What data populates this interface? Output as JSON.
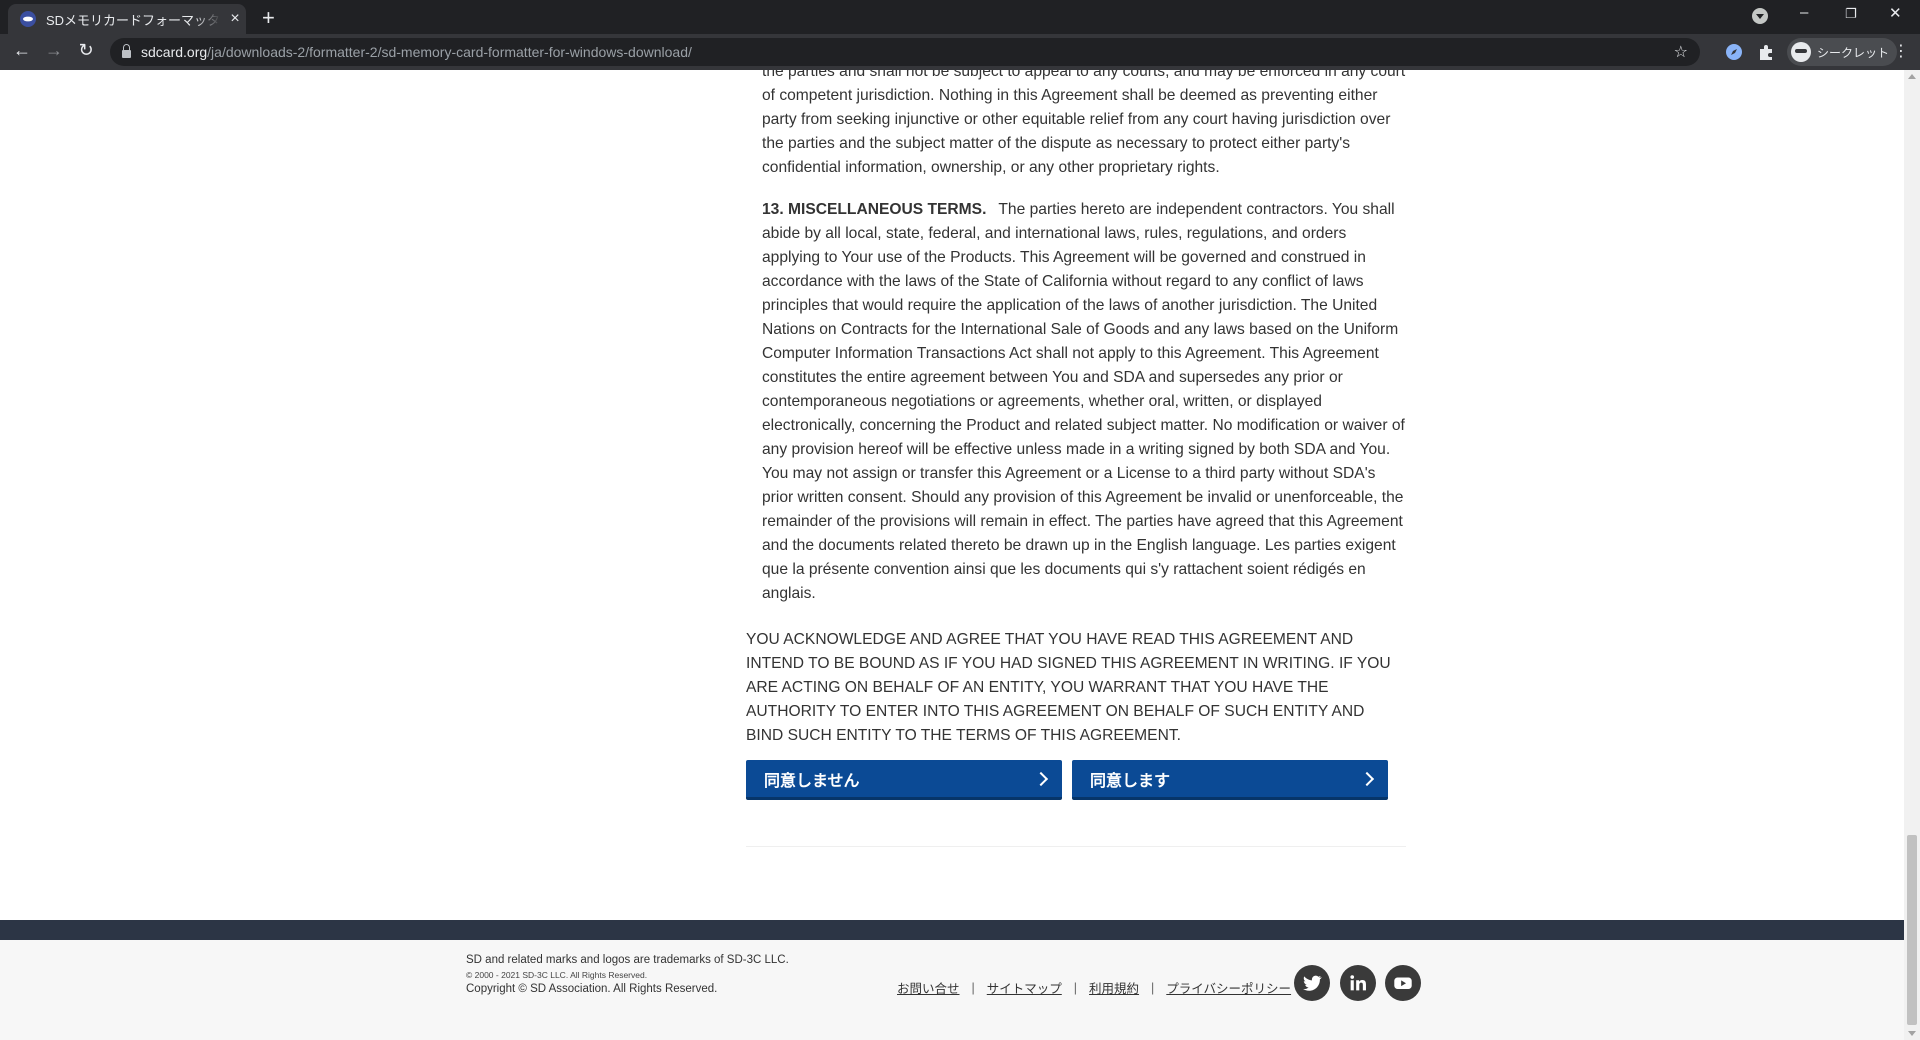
{
  "browser": {
    "tab_title": "SDメモリカードフォーマッター Windows",
    "url_host": "sdcard.org",
    "url_path": "/ja/downloads-2/formatter-2/sd-memory-card-formatter-for-windows-download/",
    "profile_label": "シークレット"
  },
  "agreement": {
    "para12_tail": "the parties and shall not be subject to appeal to any courts, and may be enforced in any court of competent jurisdiction. Nothing in this Agreement shall be deemed as preventing either party from seeking injunctive or other equitable relief from any court having jurisdiction over the parties and the subject matter of the dispute as necessary to protect either party's confidential information, ownership, or any other proprietary rights.",
    "para13_heading": "13. MISCELLANEOUS TERMS.",
    "para13_body": "The parties hereto are independent contractors. You shall abide by all local, state, federal, and international laws, rules, regulations, and orders applying to Your use of the Products. This Agreement will be governed and construed in accordance with the laws of the State of California without regard to any conflict of laws principles that would require the application of the laws of another jurisdiction. The United Nations on Contracts for the International Sale of Goods and any laws based on the Uniform Computer Information Transactions Act shall not apply to this Agreement. This Agreement constitutes the entire agreement between You and SDA and supersedes any prior or contemporaneous negotiations or agreements, whether oral, written, or displayed electronically, concerning the Product and related subject matter. No modification or waiver of any provision hereof will be effective unless made in a writing signed by both SDA and You. You may not assign or transfer this Agreement or a License to a third party without SDA's prior written consent. Should any provision of this Agreement be invalid or unenforceable, the remainder of the provisions will remain in effect. The parties have agreed that this Agreement and the documents related thereto be drawn up in the English language. Les parties exigent que la présente convention ainsi que les documents qui s'y rattachent soient rédigés en anglais.",
    "acknowledgement": "YOU ACKNOWLEDGE AND AGREE THAT YOU HAVE READ THIS AGREEMENT AND INTEND TO BE BOUND AS IF YOU HAD SIGNED THIS AGREEMENT IN WRITING. IF YOU ARE ACTING ON BEHALF OF AN ENTITY, YOU WARRANT THAT YOU HAVE THE AUTHORITY TO ENTER INTO THIS AGREEMENT ON BEHALF OF SUCH ENTITY AND BIND SUCH ENTITY TO THE TERMS OF THIS AGREEMENT.",
    "decline_label": "同意しません",
    "accept_label": "同意します"
  },
  "footer": {
    "trademark": "SD and related marks and logos are trademarks of SD-3C LLC.",
    "small_copyright": "© 2000 - 2021 SD-3C LLC. All Rights Reserved.",
    "copyright": "Copyright © SD Association. All Rights Reserved.",
    "links": [
      "お問い合せ",
      "サイトマップ",
      "利用規約",
      "プライバシーポリシー"
    ],
    "social_icons": [
      "twitter-icon",
      "linkedin-icon",
      "youtube-icon"
    ]
  },
  "colors": {
    "button_blue": "#0b4a95",
    "footer_band": "#2c3545",
    "chrome_dark": "#202124"
  }
}
